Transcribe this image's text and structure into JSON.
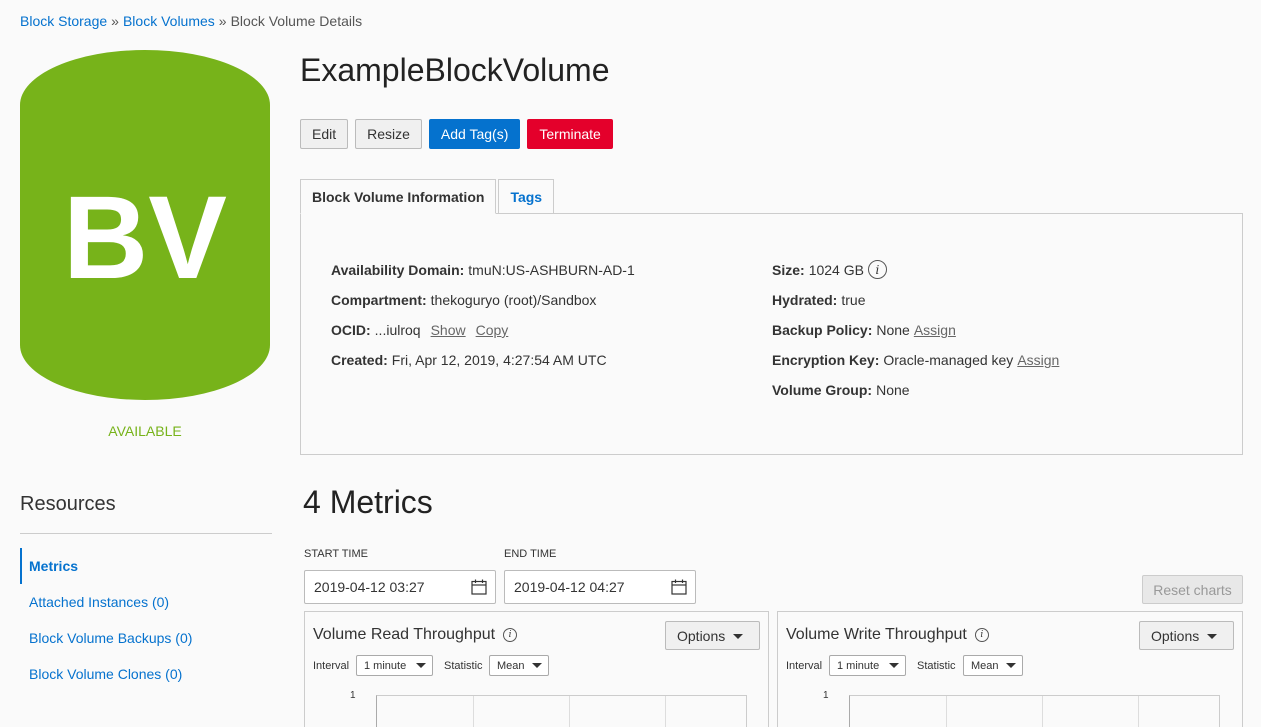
{
  "breadcrumb": {
    "items": [
      "Block Storage",
      "Block Volumes"
    ],
    "separator": "»",
    "current": "Block Volume Details"
  },
  "volume_icon": {
    "label": "BV",
    "color": "#77b31a"
  },
  "status": {
    "text": "AVAILABLE",
    "color": "#77b31a"
  },
  "page_title": "ExampleBlockVolume",
  "actions": {
    "edit": "Edit",
    "resize": "Resize",
    "add_tags": "Add Tag(s)",
    "terminate": "Terminate"
  },
  "tabs": {
    "info": "Block Volume Information",
    "tags": "Tags"
  },
  "info": {
    "availability_domain": {
      "label": "Availability Domain:",
      "value": "tmuN:US-ASHBURN-AD-1"
    },
    "compartment": {
      "label": "Compartment:",
      "value": "thekoguryo (root)/Sandbox"
    },
    "ocid": {
      "label": "OCID:",
      "value": "...iulroq",
      "show": "Show",
      "copy": "Copy"
    },
    "created": {
      "label": "Created:",
      "value": "Fri, Apr 12, 2019, 4:27:54 AM UTC"
    },
    "size": {
      "label": "Size:",
      "value": "1024 GB",
      "icon": "info-icon"
    },
    "hydrated": {
      "label": "Hydrated:",
      "value": "true"
    },
    "backup_policy": {
      "label": "Backup Policy:",
      "value": "None",
      "assign": "Assign"
    },
    "encryption_key": {
      "label": "Encryption Key:",
      "value": "Oracle-managed key",
      "assign": "Assign"
    },
    "volume_group": {
      "label": "Volume Group:",
      "value": "None"
    }
  },
  "resources": {
    "title": "Resources",
    "items": [
      {
        "label": "Metrics",
        "active": true
      },
      {
        "label": "Attached Instances (0)",
        "active": false
      },
      {
        "label": "Block Volume Backups (0)",
        "active": false
      },
      {
        "label": "Block Volume Clones (0)",
        "active": false
      }
    ]
  },
  "metrics": {
    "title": "4 Metrics",
    "start_label": "START TIME",
    "start_value": "2019-04-12 03:27",
    "end_label": "END TIME",
    "end_value": "2019-04-12 04:27",
    "reset": "Reset charts",
    "charts": [
      {
        "title": "Volume Read Throughput",
        "options": "Options",
        "interval_label": "Interval",
        "interval_value": "1 minute",
        "statistic_label": "Statistic",
        "statistic_value": "Mean",
        "y_top": "1"
      },
      {
        "title": "Volume Write Throughput",
        "options": "Options",
        "interval_label": "Interval",
        "interval_value": "1 minute",
        "statistic_label": "Statistic",
        "statistic_value": "Mean",
        "y_top": "1"
      }
    ]
  },
  "colors": {
    "link": "#0572ce",
    "primary": "#0572ce",
    "danger": "#e4002b",
    "available": "#77b31a"
  }
}
